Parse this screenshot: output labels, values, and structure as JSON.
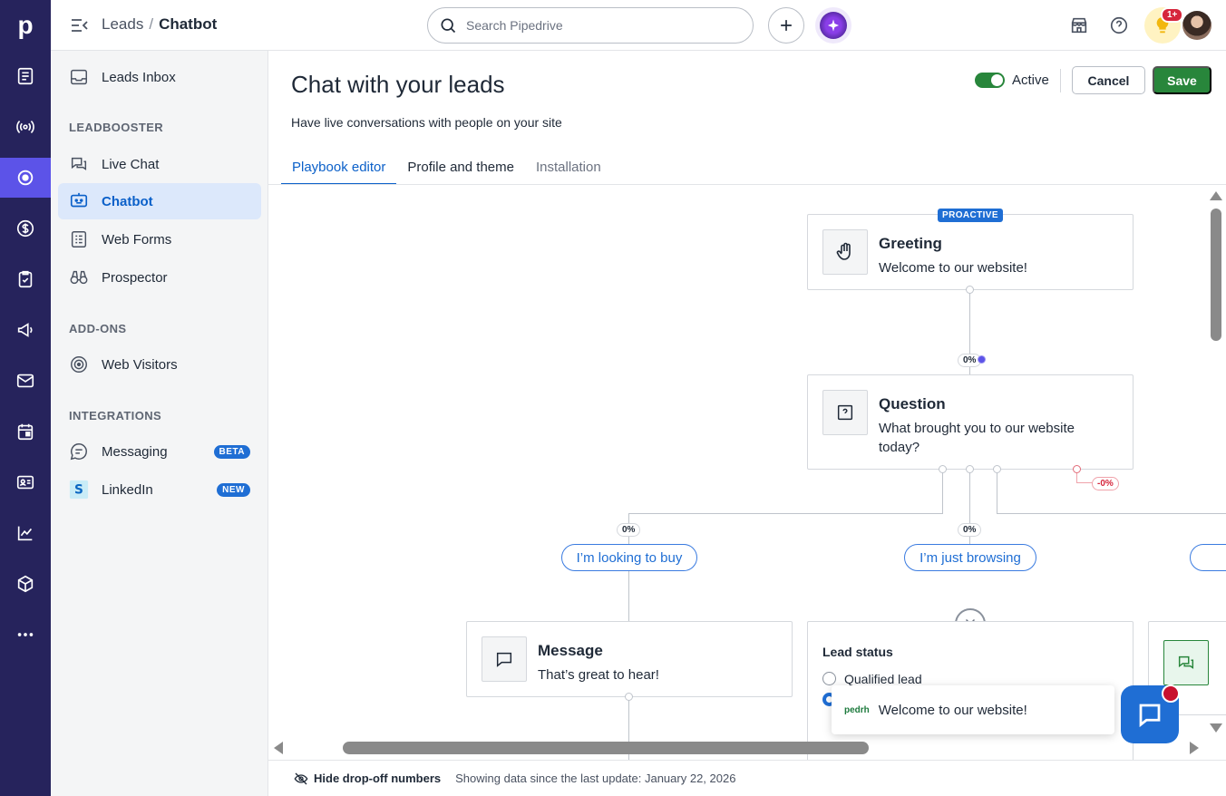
{
  "app": {
    "logo_letter": "p"
  },
  "breadcrumb": {
    "parent": "Leads",
    "separator": "/",
    "current": "Chatbot"
  },
  "search": {
    "placeholder": "Search Pipedrive"
  },
  "notifications": {
    "badge": "1+"
  },
  "sidebar": {
    "top_item": {
      "label": "Leads Inbox"
    },
    "sections": [
      {
        "title": "LEADBOOSTER"
      },
      {
        "title": "ADD-ONS"
      },
      {
        "title": "INTEGRATIONS"
      }
    ],
    "items": [
      {
        "label": "Live Chat"
      },
      {
        "label": "Chatbot"
      },
      {
        "label": "Web Forms"
      },
      {
        "label": "Prospector"
      },
      {
        "label": "Web Visitors"
      },
      {
        "label": "Messaging",
        "badge": "BETA"
      },
      {
        "label": "LinkedIn",
        "badge": "NEW"
      }
    ]
  },
  "header": {
    "title": "Chat with your leads",
    "subtitle": "Have live conversations with people on your site",
    "status_label": "Active",
    "cancel_label": "Cancel",
    "save_label": "Save"
  },
  "tabs": [
    {
      "label": "Playbook editor"
    },
    {
      "label": "Profile and theme"
    },
    {
      "label": "Installation"
    }
  ],
  "canvas": {
    "greeting": {
      "badge": "PROACTIVE",
      "title": "Greeting",
      "text": "Welcome to our website!"
    },
    "question": {
      "title": "Question",
      "text": "What brought you to our website today?",
      "pct_in": "0%",
      "pct_drop": "-0%"
    },
    "answers": [
      {
        "label": "I’m looking to buy",
        "pct": "0%"
      },
      {
        "label": "I’m just browsing",
        "pct": "0%"
      }
    ],
    "message": {
      "title": "Message",
      "text": "That’s great to hear!"
    },
    "lead_status": {
      "title": "Lead status",
      "option_1": "Qualified lead"
    },
    "widget": {
      "brand": "pedrh",
      "text": "Welcome to our website!"
    }
  },
  "footer": {
    "hide_label": "Hide drop-off numbers",
    "info": "Showing data since the last update: January 22, 2026"
  },
  "colors": {
    "rail": "#26235c",
    "accent": "#5c53e8",
    "primary_blue": "#1f6ed4",
    "save_green": "#28863b"
  }
}
